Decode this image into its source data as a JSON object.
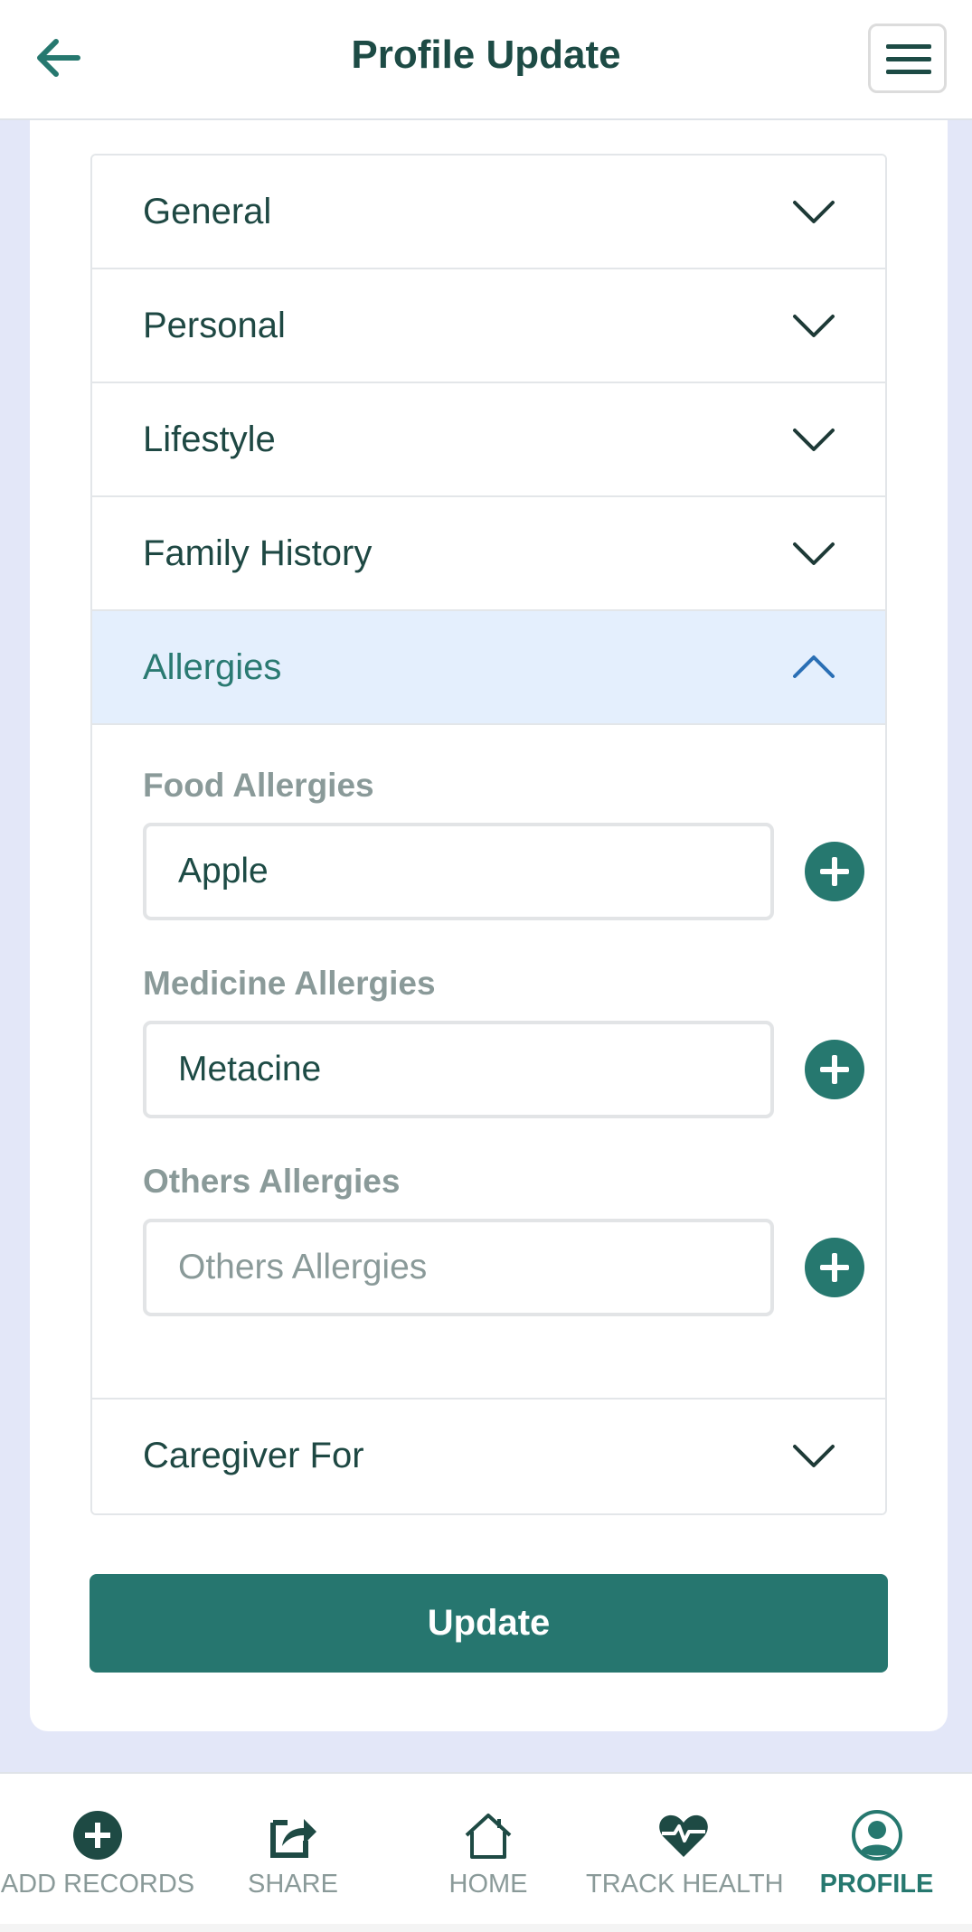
{
  "header": {
    "title": "Profile Update",
    "back_icon": "arrow-left-icon",
    "menu_icon": "hamburger-menu-icon"
  },
  "accordion": {
    "sections": [
      {
        "label": "General",
        "expanded": false
      },
      {
        "label": "Personal",
        "expanded": false
      },
      {
        "label": "Lifestyle",
        "expanded": false
      },
      {
        "label": "Family History",
        "expanded": false
      },
      {
        "label": "Allergies",
        "expanded": true
      },
      {
        "label": "Caregiver For",
        "expanded": false
      }
    ]
  },
  "allergies": {
    "food": {
      "label": "Food Allergies",
      "value": "Apple",
      "placeholder": ""
    },
    "medicine": {
      "label": "Medicine Allergies",
      "value": "Metacine",
      "placeholder": ""
    },
    "others": {
      "label": "Others Allergies",
      "value": "",
      "placeholder": "Others Allergies"
    }
  },
  "update_button": {
    "label": "Update"
  },
  "bottom_nav": {
    "items": [
      {
        "label": "ADD RECORDS",
        "icon": "plus-circle-icon",
        "active": false
      },
      {
        "label": "SHARE",
        "icon": "share-icon",
        "active": false
      },
      {
        "label": "HOME",
        "icon": "home-icon",
        "active": false
      },
      {
        "label": "TRACK HEALTH",
        "icon": "heartbeat-icon",
        "active": false
      },
      {
        "label": "PROFILE",
        "icon": "user-circle-icon",
        "active": true
      }
    ]
  },
  "colors": {
    "primary": "#26766f",
    "title_text": "#1d4b45",
    "muted_text": "#8a9a99",
    "active_section_bg": "#e4effd",
    "page_bg": "#e3e7f8"
  }
}
